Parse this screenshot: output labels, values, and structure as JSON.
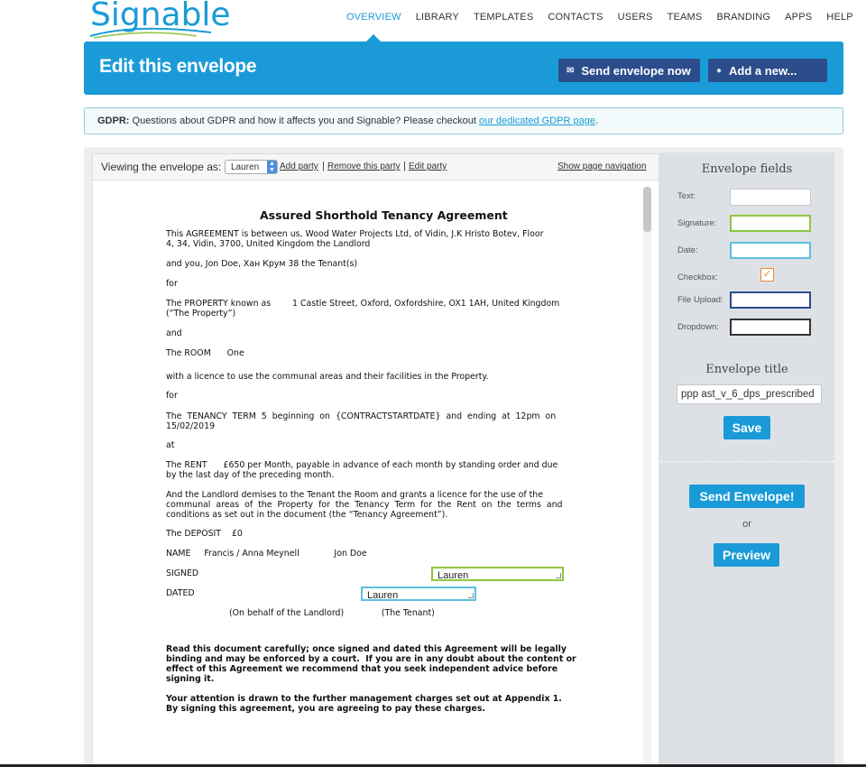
{
  "brand": {
    "logo_text": "Signable",
    "accent": "#1a9bd7",
    "dark": "#2b4d8c"
  },
  "nav": {
    "items": [
      {
        "label": "OVERVIEW",
        "active": true
      },
      {
        "label": "LIBRARY"
      },
      {
        "label": "TEMPLATES"
      },
      {
        "label": "CONTACTS"
      },
      {
        "label": "USERS"
      },
      {
        "label": "TEAMS"
      },
      {
        "label": "BRANDING"
      },
      {
        "label": "APPS"
      },
      {
        "label": "HELP"
      }
    ]
  },
  "header": {
    "title": "Edit this envelope",
    "send_now_label": "Send envelope now",
    "send_now_icon": "envelope-icon",
    "add_new_label": "Add a new...",
    "add_new_icon": "plus-circle-icon"
  },
  "gdpr": {
    "label": "GDPR:",
    "text": "Questions about GDPR and how it affects you and Signable? Please checkout",
    "link": "our dedicated GDPR page",
    "tail": "."
  },
  "toolbar": {
    "viewing_label": "Viewing the envelope as:",
    "party_selected": "Lauren",
    "add_party": "Add party",
    "remove_party": "Remove this party",
    "edit_party": "Edit party",
    "sep": "|",
    "show_nav": "Show page navigation"
  },
  "document": {
    "title": "Assured Shorthold Tenancy Agreement",
    "agreement_line1": "This AGREEMENT is between us, Wood Water Projects Ltd, of Vidin, J.K Hristo Botev, Floor",
    "agreement_line2": "4, 34, Vidin, 3700, United Kingdom the Landlord",
    "you_line": "and you, Jon Doe, Хан Крум 38 the Tenant(s)",
    "for1": "for",
    "property_line1": "The PROPERTY known as        1 Castle Street, Oxford, Oxfordshire, OX1 1AH, United Kingdom",
    "property_line2": "(“The Property”)",
    "and": "and",
    "room_line": "The ROOM      One",
    "licence_line": "with a licence to use the communal areas and their facilities in the Property.",
    "for2": "for",
    "term_line1": "The  TENANCY  TERM  5  beginning  on  {CONTRACTSTARTDATE}  and  ending  at  12pm  on",
    "term_line2": "15/02/2019",
    "at": "at",
    "rent_line1": "The RENT      £650 per Month, payable in advance of each month by standing order and due",
    "rent_line2": "by the last day of the preceding month.",
    "demise_line1": "And the Landlord demises to the Tenant the Room and grants a licence for the use of the",
    "demise_line2": "communal  areas  of  the  Property  for  the  Tenancy  Term  for  the  Rent  on  the  terms  and",
    "demise_line3": "conditions as set out in the document (the “Tenancy Agreement”).",
    "deposit_line": "The DEPOSIT    £0",
    "name_line": "NAME     Francis / Anna Meynell             Jon Doe",
    "signed": "SIGNED",
    "dated": "DATED",
    "behalf_line": "(On behalf of the Landlord)              (The Tenant)",
    "read_line1": "Read this document carefully; once signed and dated this Agreement will be legally",
    "read_line2": "binding and may be enforced by a court.  If you are in any doubt about the content or",
    "read_line3": "effect of this Agreement we recommend that you seek independent advice before",
    "read_line4": "signing it.",
    "attn_line1": "Your attention is drawn to the further management charges set out at Appendix 1.",
    "attn_line2": "By signing this agreement, you are agreeing to pay these charges.",
    "signature_field_value": "Lauren",
    "date_field_value": "Lauren"
  },
  "panel": {
    "fields_heading": "Envelope fields",
    "fields": [
      {
        "label": "Text:",
        "color": "#c8c8c8"
      },
      {
        "label": "Signature:",
        "color": "#8dc63f"
      },
      {
        "label": "Date:",
        "color": "#5bc0de"
      },
      {
        "label": "Checkbox:",
        "color": "#f08a30"
      },
      {
        "label": "File Upload:",
        "color": "#2b4d8c"
      },
      {
        "label": "Dropdown:",
        "color": "#333333"
      }
    ],
    "title_heading": "Envelope title",
    "title_value": "ppp ast_v_6_dps_prescribed",
    "save_label": "Save",
    "send_label": "Send Envelope!",
    "or_label": "or",
    "preview_label": "Preview"
  }
}
